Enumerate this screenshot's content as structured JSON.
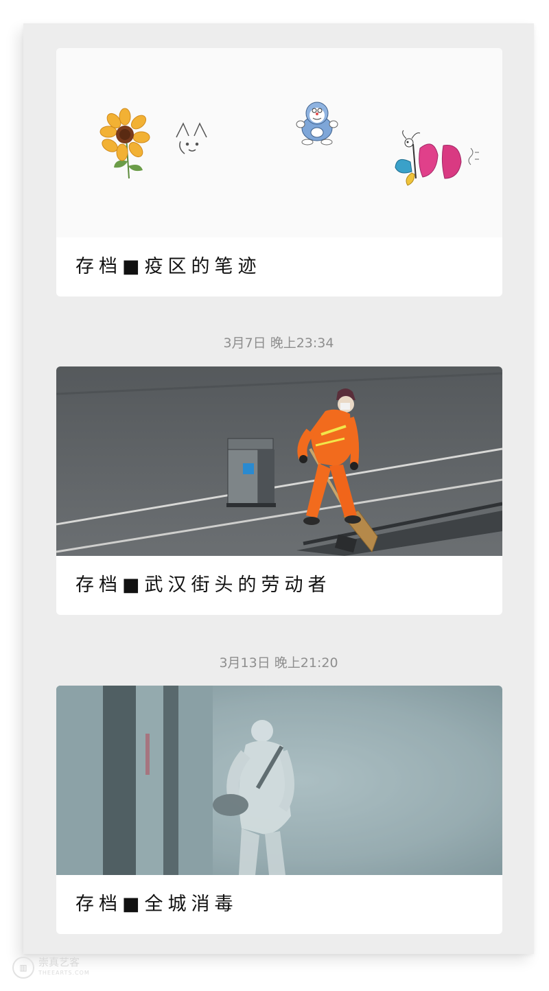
{
  "feed": {
    "items": [
      {
        "title": "存档■疫区的笔迹",
        "image": "children-drawings-sunflower-cat-doraemon-butterfly"
      },
      {
        "timestamp": "3月7日 晚上23:34",
        "title": "存档■武汉街头的劳动者",
        "image": "street-sweeper-orange-uniform"
      },
      {
        "timestamp": "3月13日 晚上21:20",
        "title": "存档■全城消毒",
        "image": "disinfection-worker-in-mist"
      }
    ]
  },
  "watermark": {
    "icon": "museum-logo-icon",
    "name": "崇真艺客",
    "sub": "THEEARTS.COM"
  },
  "colors": {
    "background": "#ededed",
    "card": "#ffffff",
    "timestamp": "#8e8e8e",
    "sweeper_orange": "#f26b1d"
  }
}
